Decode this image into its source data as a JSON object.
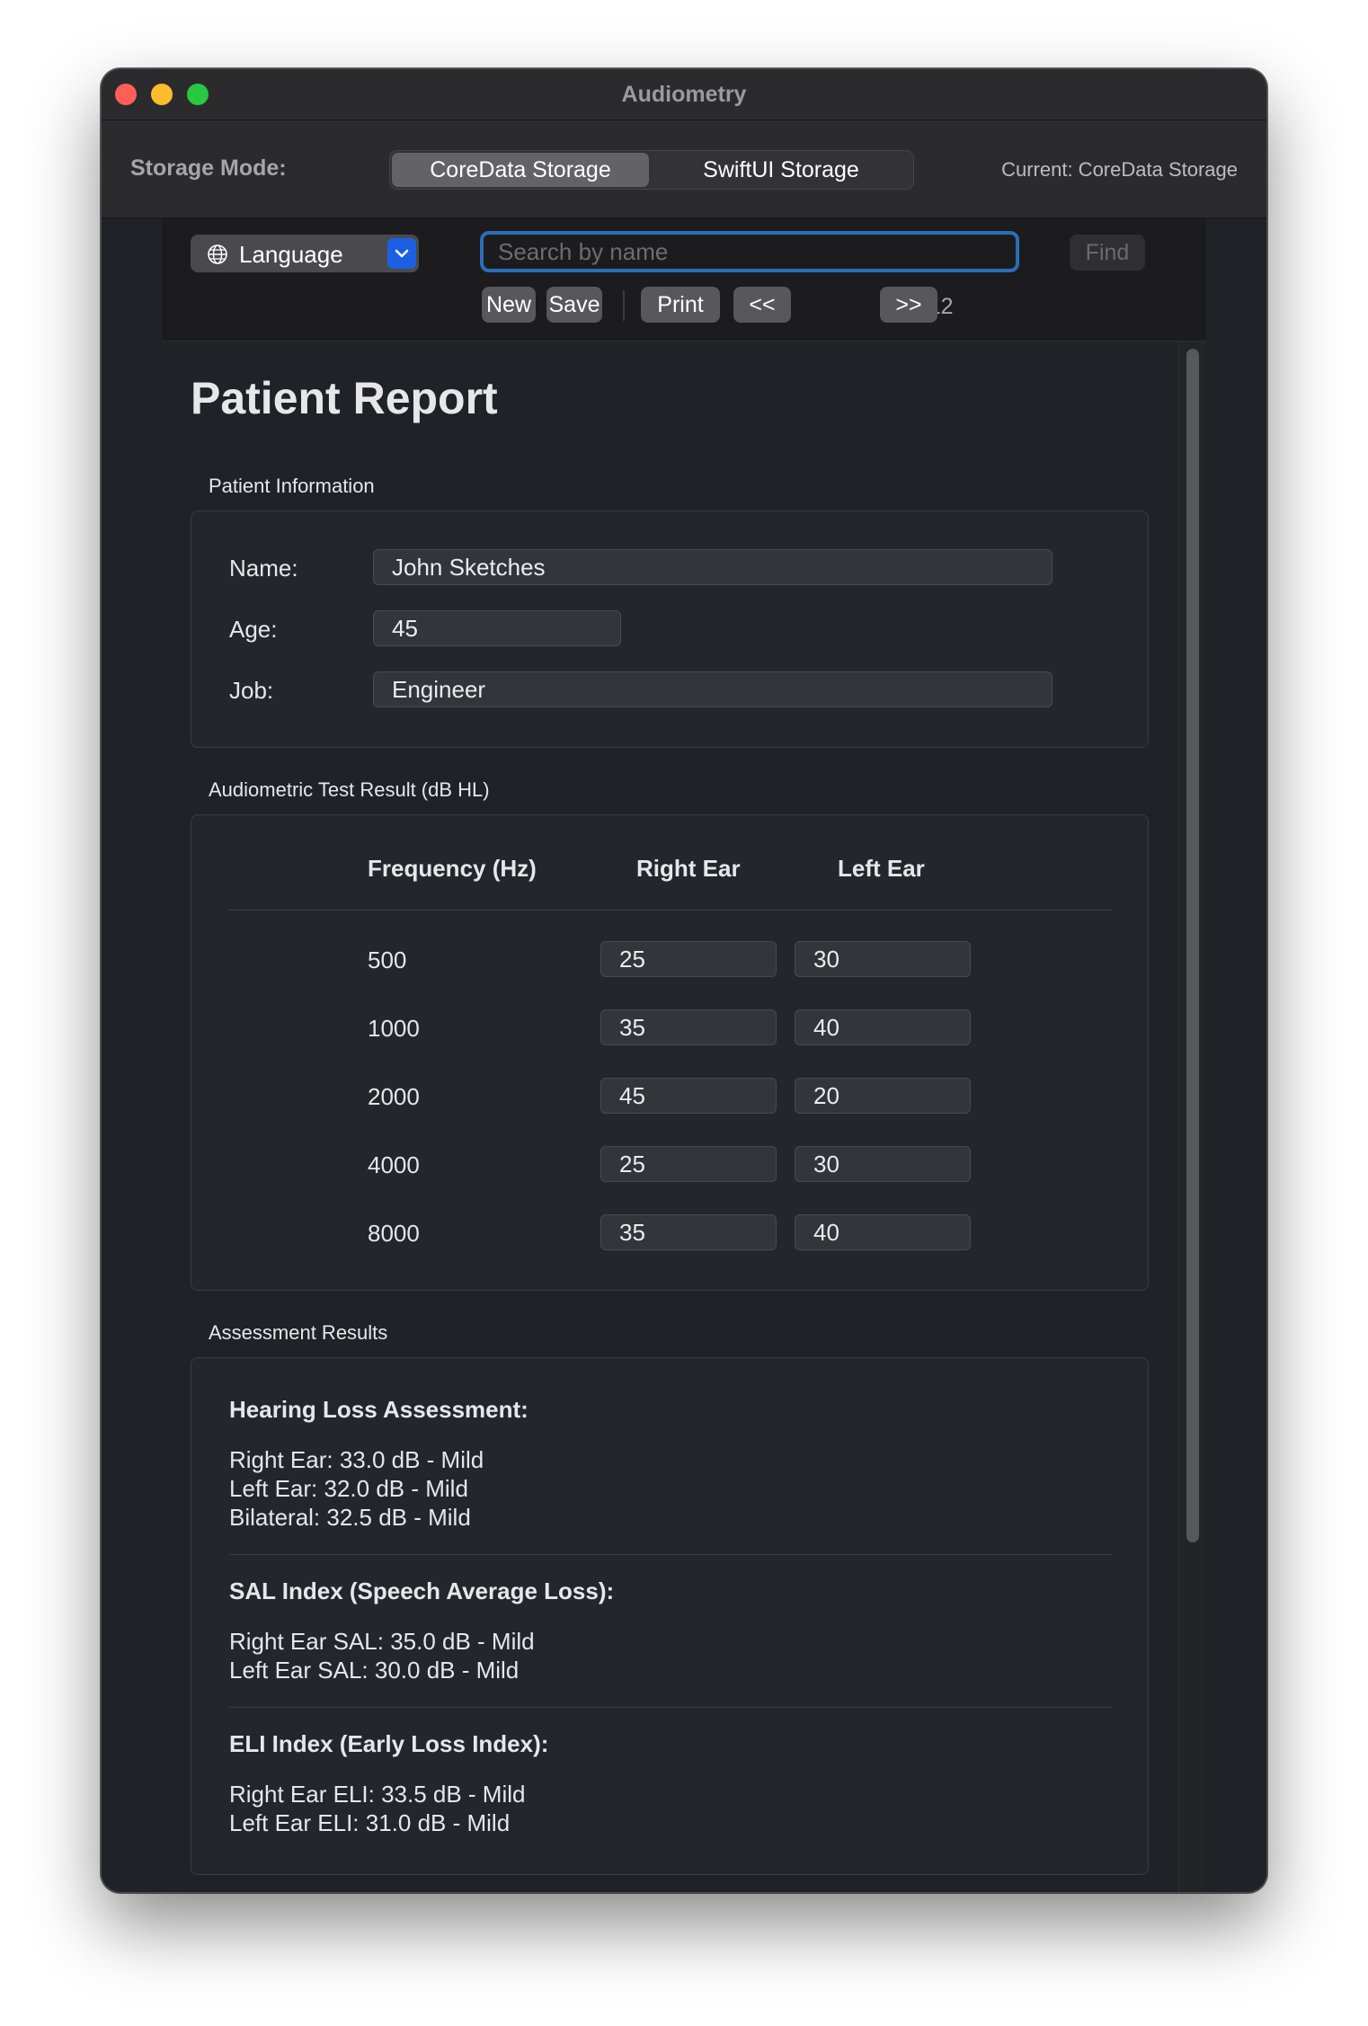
{
  "window": {
    "title": "Audiometry"
  },
  "storage": {
    "label": "Storage Mode:",
    "options": [
      "CoreData Storage",
      "SwiftUI Storage"
    ],
    "selected": "CoreData Storage",
    "current": "Current: CoreData Storage"
  },
  "toolbar": {
    "language_label": "Language",
    "search_placeholder": "Search by name",
    "find_label": "Find",
    "new_label": "New",
    "save_label": "Save",
    "print_label": "Print",
    "prev_label": "<<",
    "next_label": ">>",
    "counter": "5 / 12"
  },
  "report": {
    "title": "Patient Report",
    "patient_section": "Patient Information",
    "fields": {
      "name_label": "Name:",
      "name_value": "John Sketches",
      "age_label": "Age:",
      "age_value": "45",
      "job_label": "Job:",
      "job_value": "Engineer"
    },
    "test_section": "Audiometric Test Result (dB HL)",
    "columns": [
      "Frequency (Hz)",
      "Right Ear",
      "Left Ear"
    ],
    "rows": [
      {
        "frequency": "500",
        "right": "25",
        "left": "30"
      },
      {
        "frequency": "1000",
        "right": "35",
        "left": "40"
      },
      {
        "frequency": "2000",
        "right": "45",
        "left": "20"
      },
      {
        "frequency": "4000",
        "right": "25",
        "left": "30"
      },
      {
        "frequency": "8000",
        "right": "35",
        "left": "40"
      }
    ],
    "assessment_section": "Assessment Results",
    "assessment": {
      "hearing_title": "Hearing Loss Assessment:",
      "hearing_lines": [
        "Right Ear: 33.0 dB - Mild",
        "Left Ear: 32.0 dB - Mild",
        "Bilateral: 32.5 dB - Mild"
      ],
      "sal_title": "SAL Index (Speech Average Loss):",
      "sal_lines": [
        "Right Ear SAL: 35.0 dB - Mild",
        "Left Ear SAL: 30.0 dB - Mild"
      ],
      "eli_title": "ELI Index (Early Loss Index):",
      "eli_lines": [
        "Right Ear ELI: 33.5 dB - Mild",
        "Left Ear ELI: 31.0 dB - Mild"
      ]
    }
  },
  "icons": [
    "globe-icon",
    "chevron-down-icon"
  ],
  "colors": {
    "accent": "#1d5fe2",
    "focus_ring": "#2a6eb8",
    "close": "#ff5f57",
    "minimize": "#febc2e",
    "zoom": "#28c840"
  }
}
